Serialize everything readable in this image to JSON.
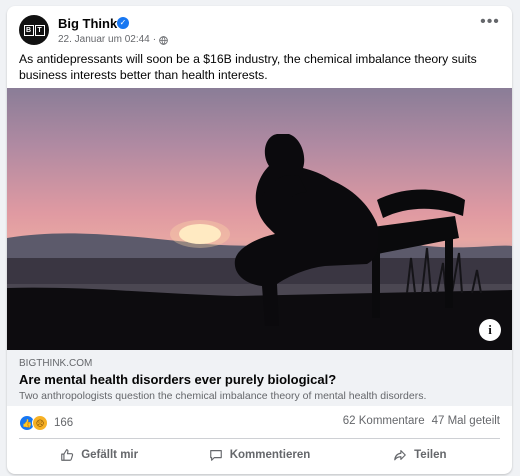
{
  "post": {
    "page_name": "Big Think",
    "avatar_letters": [
      "B",
      "T"
    ],
    "timestamp": "22. Januar um 02:44",
    "separator": "·",
    "more_label": "•••",
    "text": "As antidepressants will soon be a $16B industry, the chemical imbalance theory suits business interests better than health interests."
  },
  "link": {
    "domain": "BIGTHINK.COM",
    "title": "Are mental health disorders ever purely biological?",
    "description": "Two anthropologists question the chemical imbalance theory of mental health disorders.",
    "info_label": "i"
  },
  "stats": {
    "reaction_count": "166",
    "comments": "62 Kommentare",
    "shares": "47 Mal geteilt",
    "reactions": [
      "like-icon",
      "sad-icon"
    ]
  },
  "actions": {
    "like": "Gefällt mir",
    "comment": "Kommentieren",
    "share": "Teilen"
  },
  "colors": {
    "accent": "#1877f2",
    "muted_text": "#65676b",
    "link_box_bg": "#f0f2f5"
  }
}
